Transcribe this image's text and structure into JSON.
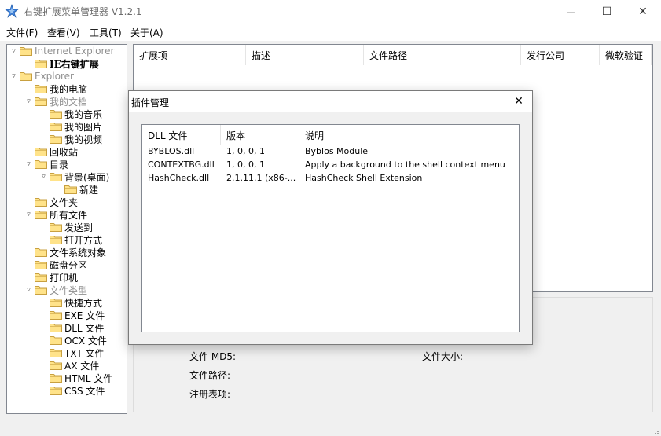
{
  "window": {
    "title": "右键扩展菜单管理器 V1.2.1",
    "minimize_glyph": "—",
    "maximize_glyph": "☐",
    "close_glyph": "✕"
  },
  "menu": [
    "文件(F)",
    "查看(V)",
    "工具(T)",
    "关于(A)"
  ],
  "tree": {
    "ie_root": "Internet Explorer",
    "ie_ext": "IE右键扩展",
    "explorer": "Explorer",
    "my_computer": "我的电脑",
    "my_docs": "我的文档",
    "my_music": "我的音乐",
    "my_pictures": "我的图片",
    "my_videos": "我的视频",
    "recycle_bin": "回收站",
    "directory": "目录",
    "background": "背景(桌面)",
    "new": "新建",
    "folder": "文件夹",
    "all_files": "所有文件",
    "send_to": "发送到",
    "open_with": "打开方式",
    "fs_objects": "文件系统对象",
    "drive": "磁盘分区",
    "printer": "打印机",
    "file_types": "文件类型",
    "shortcut": "快捷方式",
    "exe": "EXE 文件",
    "dll": "DLL 文件",
    "ocx": "OCX 文件",
    "txt": "TXT 文件",
    "ax": "AX 文件",
    "html": "HTML 文件",
    "css": "CSS 文件"
  },
  "list": {
    "columns": [
      "扩展项",
      "描述",
      "文件路径",
      "发行公司",
      "微软验证"
    ]
  },
  "info": {
    "md5": "文件 MD5:",
    "size": "文件大小:",
    "path": "文件路径:",
    "registry": "注册表项:"
  },
  "dialog": {
    "title": "插件管理",
    "close_glyph": "✕",
    "columns": [
      "DLL 文件",
      "版本",
      "说明"
    ],
    "rows": [
      {
        "file": "BYBLOS.dll",
        "version": "1, 0, 0, 1",
        "desc": "Byblos Module"
      },
      {
        "file": "CONTEXTBG.dll",
        "version": "1, 0, 0, 1",
        "desc": "Apply a background to the shell context menu"
      },
      {
        "file": "HashCheck.dll",
        "version": "2.1.11.1 (x86-...",
        "desc": "HashCheck Shell Extension"
      }
    ]
  },
  "colors": {
    "folder_fill": "#ffe38a",
    "folder_stroke": "#c8a040",
    "pane_border": "#828790",
    "disabled_text": "#909090"
  }
}
